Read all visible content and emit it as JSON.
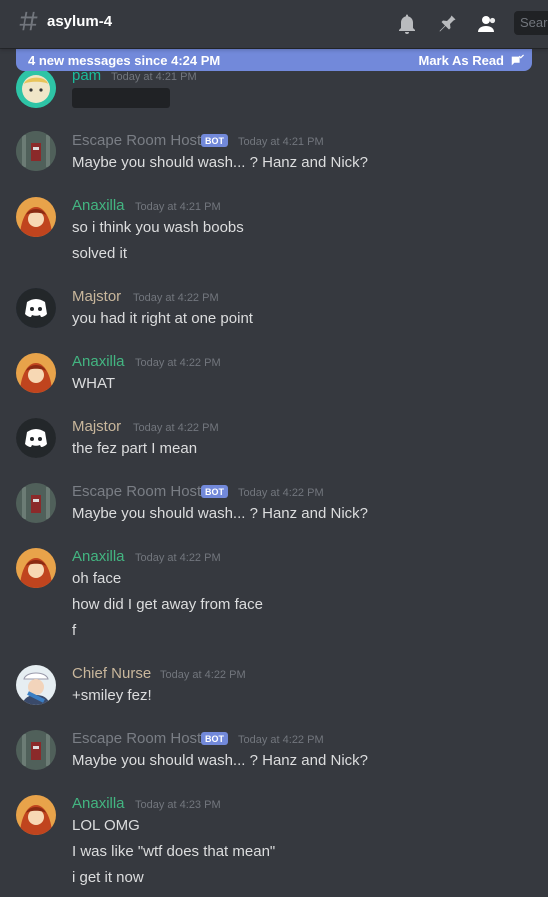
{
  "header": {
    "channel_name": "asylum-4",
    "search_placeholder": "Sear"
  },
  "new_messages_bar": {
    "text": "4 new messages since 4:24 PM",
    "mark_read": "Mark As Read"
  },
  "colors": {
    "pam": "#1abc9c",
    "host": "#7a7e85",
    "anaxilla": "#43b581",
    "majstor": "#c9b79c",
    "nurse": "#c9b79c",
    "bot": "#7289da"
  },
  "messages": [
    {
      "username": "pam",
      "timestamp": "Today at 4:21 PM",
      "lines": []
    },
    {
      "username": "Escape Room Host",
      "bot": "BOT",
      "timestamp": "Today at 4:21 PM",
      "lines": [
        "Maybe you should wash... ? Hanz and Nick?"
      ]
    },
    {
      "username": "Anaxilla",
      "timestamp": "Today at 4:21 PM",
      "lines": [
        "so i think you wash boobs",
        "solved it"
      ]
    },
    {
      "username": "Majstor",
      "timestamp": "Today at 4:22 PM",
      "lines": [
        "you had it right at one point"
      ]
    },
    {
      "username": "Anaxilla",
      "timestamp": "Today at 4:22 PM",
      "lines": [
        "WHAT"
      ]
    },
    {
      "username": "Majstor",
      "timestamp": "Today at 4:22 PM",
      "lines": [
        "the fez part I mean"
      ]
    },
    {
      "username": "Escape Room Host",
      "bot": "BOT",
      "timestamp": "Today at 4:22 PM",
      "lines": [
        "Maybe you should wash... ? Hanz and Nick?"
      ]
    },
    {
      "username": "Anaxilla",
      "timestamp": "Today at 4:22 PM",
      "lines": [
        "oh face",
        "how did I get away from face",
        "f"
      ]
    },
    {
      "username": "Chief Nurse",
      "timestamp": "Today at 4:22 PM",
      "lines": [
        "+smiley fez!"
      ]
    },
    {
      "username": "Escape Room Host",
      "bot": "BOT",
      "timestamp": "Today at 4:22 PM",
      "lines": [
        "Maybe you should wash... ? Hanz and Nick?"
      ]
    },
    {
      "username": "Anaxilla",
      "timestamp": "Today at 4:23 PM",
      "lines": [
        "LOL OMG",
        "I was like \"wtf does that mean\"",
        "i get it now"
      ]
    }
  ]
}
